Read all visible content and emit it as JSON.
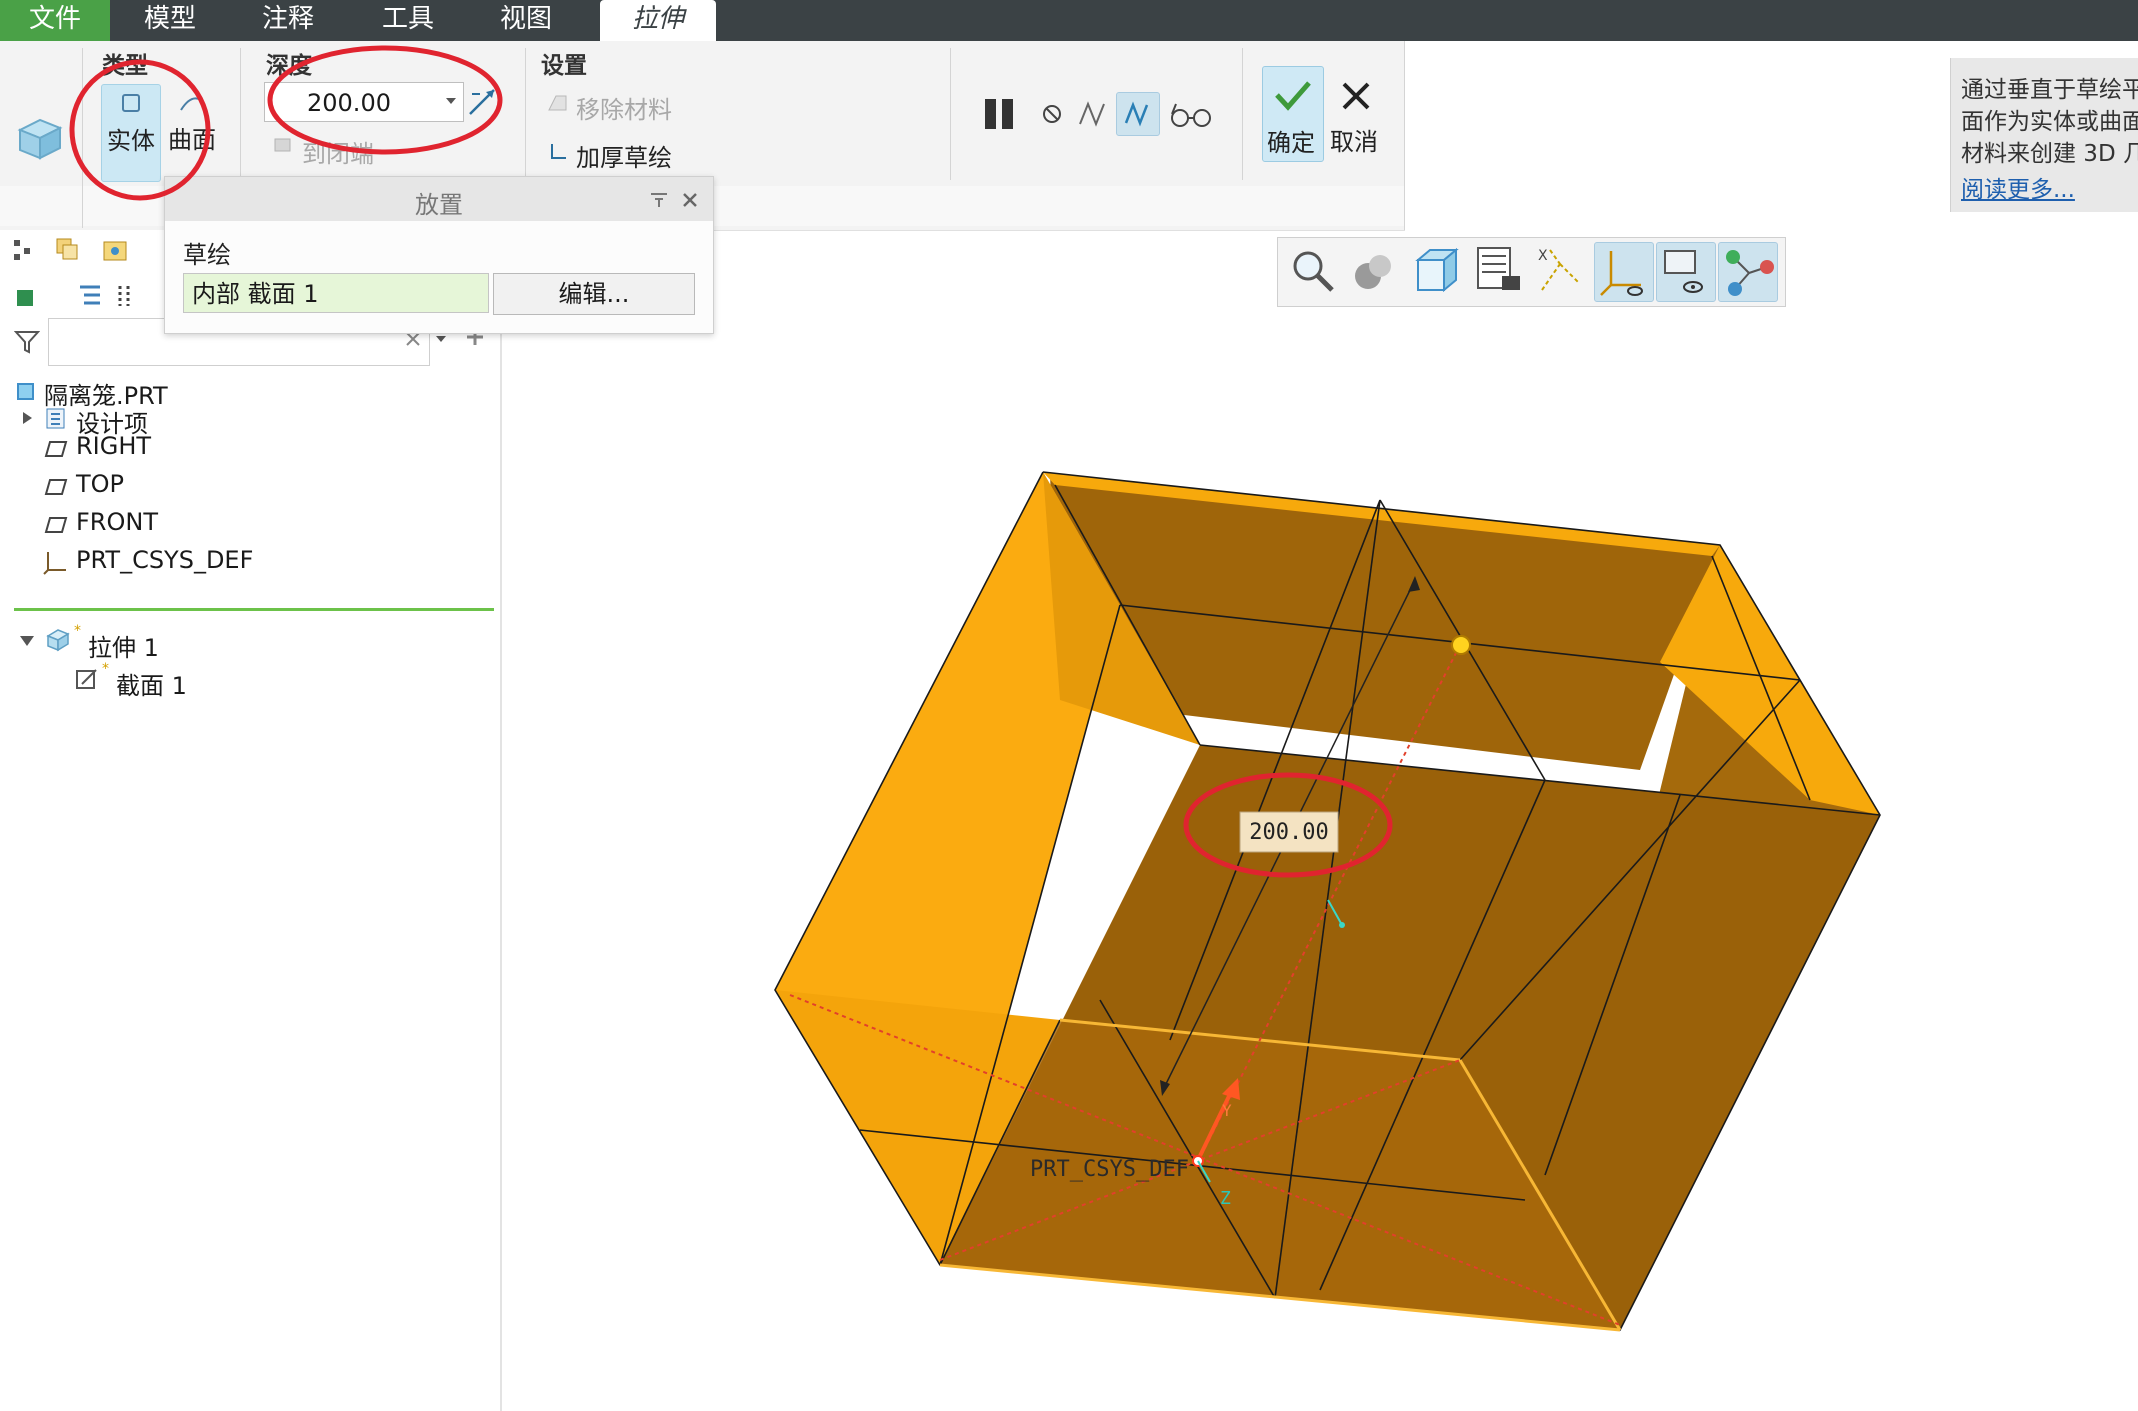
{
  "menu": {
    "file": "文件",
    "model": "模型",
    "annotate": "注释",
    "tools": "工具",
    "view": "视图",
    "extrude_tab": "拉伸"
  },
  "ribbon": {
    "type_group": {
      "title": "类型",
      "solid": "实体",
      "surface": "曲面"
    },
    "depth_group": {
      "title": "深度",
      "value": "200.00",
      "to_closed": "到闭端"
    },
    "settings_group": {
      "title": "设置",
      "remove_material": "移除材料",
      "thicken_sketch": "加厚草绘"
    },
    "confirm": "确定",
    "cancel": "取消"
  },
  "help": {
    "line1": "通过垂直于草绘平",
    "line2": "面作为实体或曲面",
    "line3": "材料来创建 3D 几",
    "read_more": "阅读更多..."
  },
  "placement": {
    "title": "放置",
    "sketch_label": "草绘",
    "section_value": "内部 截面 1",
    "edit_button": "编辑..."
  },
  "tree": {
    "search_placeholder": "",
    "items": [
      {
        "label": "隔离笼.PRT"
      },
      {
        "label": "设计项"
      },
      {
        "label": "RIGHT"
      },
      {
        "label": "TOP"
      },
      {
        "label": "FRONT"
      },
      {
        "label": "PRT_CSYS_DEF"
      },
      {
        "label": "拉伸 1"
      },
      {
        "label": "截面 1"
      }
    ]
  },
  "graphics": {
    "depth_dim": "200.00",
    "csys_label": "PRT_CSYS_DEF",
    "axis_z": "Z",
    "axis_y": "Y"
  },
  "colors": {
    "menubar": "#3b4245",
    "file_tab": "#4aa147",
    "solid_orange": "#f9a608",
    "dark_face": "#9b6209",
    "highlight_circle": "#e0242f"
  }
}
